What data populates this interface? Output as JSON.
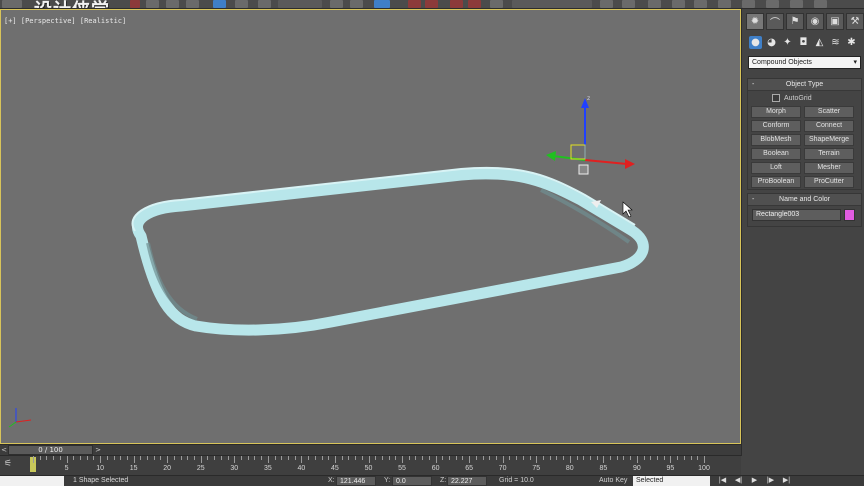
{
  "watermark": "设计侠学",
  "viewport": {
    "label": "[+] [Perspective] [Realistic]"
  },
  "command_panel": {
    "tabs": [
      "create-icon",
      "modify-icon",
      "hierarchy-icon",
      "motion-icon",
      "display-icon",
      "utilities-icon"
    ],
    "subtabs": [
      "geometry-icon",
      "shapes-icon",
      "lights-icon",
      "cameras-icon",
      "helpers-icon",
      "spacewarps-icon",
      "systems-icon"
    ],
    "category": "Compound Objects",
    "object_type": {
      "title": "Object Type",
      "autogrid_label": "AutoGrid",
      "buttons": [
        "Morph",
        "Scatter",
        "Conform",
        "Connect",
        "BlobMesh",
        "ShapeMerge",
        "Boolean",
        "Terrain",
        "Loft",
        "Mesher",
        "ProBoolean",
        "ProCutter"
      ]
    },
    "name_and_color": {
      "title": "Name and Color",
      "name": "Rectangle003",
      "color": "#e05ce0"
    }
  },
  "time_slider": {
    "label": "0 / 100",
    "prev": "<",
    "next": ">"
  },
  "trackbar": {
    "ticks": [
      "5",
      "10",
      "15",
      "20",
      "25",
      "30",
      "35",
      "40",
      "45",
      "50",
      "55",
      "60",
      "65",
      "70",
      "75",
      "80",
      "85",
      "90",
      "95",
      "100"
    ]
  },
  "status": {
    "selection": "1 Shape Selected",
    "x_label": "X:",
    "x_value": "121.446",
    "y_label": "Y:",
    "y_value": "0.0",
    "z_label": "Z:",
    "z_value": "22.227",
    "grid": "Grid = 10.0",
    "auto_key": "Auto Key",
    "selected": "Selected"
  },
  "colors": {
    "viewport_border": "#d8c45a",
    "shape": "#b8e6ea",
    "gizmo_x": "#e02020",
    "gizmo_y": "#20c020",
    "gizmo_z": "#2040ff"
  }
}
